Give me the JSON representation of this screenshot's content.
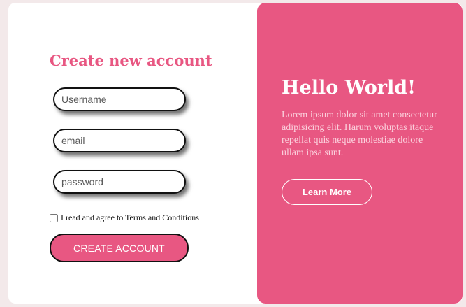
{
  "colors": {
    "accent": "#e85782",
    "background": "#f3e9ea",
    "card": "#ffffff"
  },
  "form": {
    "title": "Create new account",
    "username_placeholder": "Username",
    "email_placeholder": "email",
    "password_placeholder": "password",
    "terms_label": "I read and agree to Terms and Conditions",
    "terms_checked": false,
    "submit_label": "CREATE ACCOUNT"
  },
  "side": {
    "title": "Hello World!",
    "text": "Lorem ipsum dolor sit amet consectetur adipisicing elit. Harum voluptas itaque repellat quis neque molestiae dolore ullam ipsa sunt.",
    "button_label": "Learn More"
  }
}
